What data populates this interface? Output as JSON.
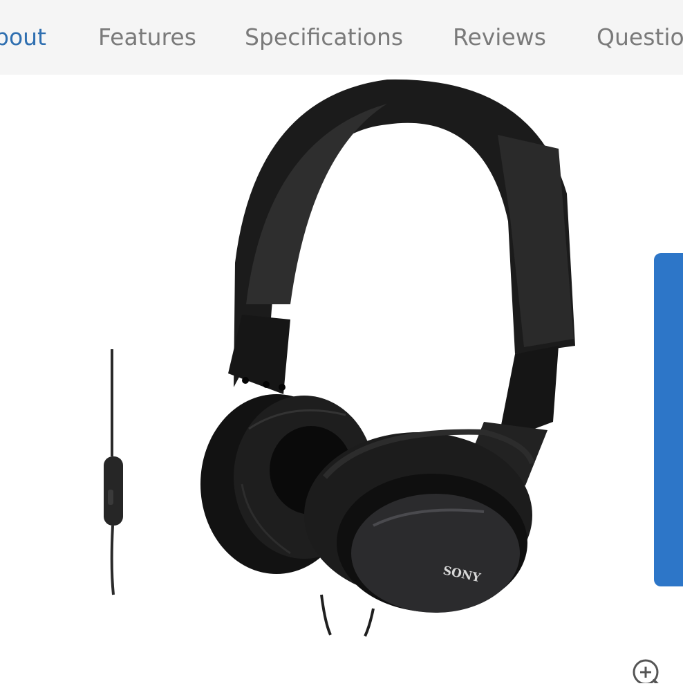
{
  "nav": {
    "tabs": [
      {
        "label": "About",
        "visible_text": "bout",
        "active": true
      },
      {
        "label": "Features",
        "active": false
      },
      {
        "label": "Specifications",
        "active": false
      },
      {
        "label": "Reviews",
        "active": false
      },
      {
        "label": "Questio",
        "active": false
      }
    ]
  },
  "product_image": {
    "logo_text": "SONY"
  },
  "icons": {
    "zoom": "zoom-in-icon"
  },
  "colors": {
    "active_tab": "#2f6fb0",
    "inactive_tab": "#7a7a7a",
    "tabbar_bg": "#f5f5f5",
    "side_panel": "#2d76c8"
  }
}
